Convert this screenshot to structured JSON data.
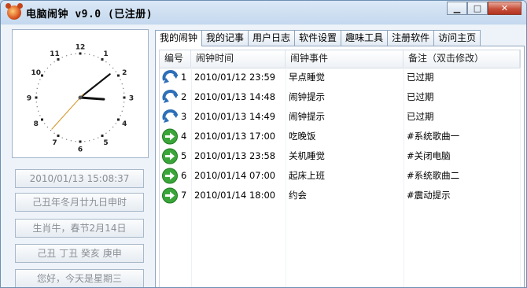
{
  "window": {
    "title": "电脑闹钟 v9.0 (已注册)",
    "buttons": [
      "minimize",
      "maximize",
      "close"
    ]
  },
  "clock": {
    "numbers": [
      "12",
      "1",
      "2",
      "3",
      "4",
      "5",
      "6",
      "7",
      "8",
      "9",
      "10",
      "11"
    ],
    "time": {
      "hour": 3,
      "minute": 8,
      "second": 37
    }
  },
  "info": {
    "datetime": "2010/01/13 15:08:37",
    "lunar": "己丑年冬月廿九日申时",
    "zodiac": "生肖牛，春节2月14日",
    "ganzhi": "己丑 丁丑 癸亥 庚申",
    "greeting": "您好，今天是星期三"
  },
  "tabs": [
    "我的闹钟",
    "我的记事",
    "用户日志",
    "软件设置",
    "趣味工具",
    "注册软件",
    "访问主页"
  ],
  "table": {
    "headers": [
      "编号",
      "闹钟时间",
      "闹钟事件",
      "备注（双击修改）"
    ],
    "rows": [
      {
        "icon": "repeat-arrow-icon",
        "num": "1",
        "time": "2010/01/12 23:59",
        "event": "早点睡觉",
        "note": "已过期"
      },
      {
        "icon": "repeat-arrow-icon",
        "num": "2",
        "time": "2010/01/13 14:48",
        "event": "闹钟提示",
        "note": "已过期"
      },
      {
        "icon": "repeat-arrow-icon",
        "num": "3",
        "time": "2010/01/13 14:49",
        "event": "闹钟提示",
        "note": "已过期"
      },
      {
        "icon": "green-arrow-icon",
        "num": "4",
        "time": "2010/01/13 17:00",
        "event": "吃晚饭",
        "note": "#系统歌曲一"
      },
      {
        "icon": "green-arrow-icon",
        "num": "5",
        "time": "2010/01/13 23:58",
        "event": "关机睡觉",
        "note": "#关闭电脑"
      },
      {
        "icon": "green-arrow-icon",
        "num": "6",
        "time": "2010/01/14 07:00",
        "event": "起床上班",
        "note": "#系统歌曲二"
      },
      {
        "icon": "green-arrow-icon",
        "num": "7",
        "time": "2010/01/14 18:00",
        "event": "约会",
        "note": "#震动提示"
      }
    ]
  }
}
